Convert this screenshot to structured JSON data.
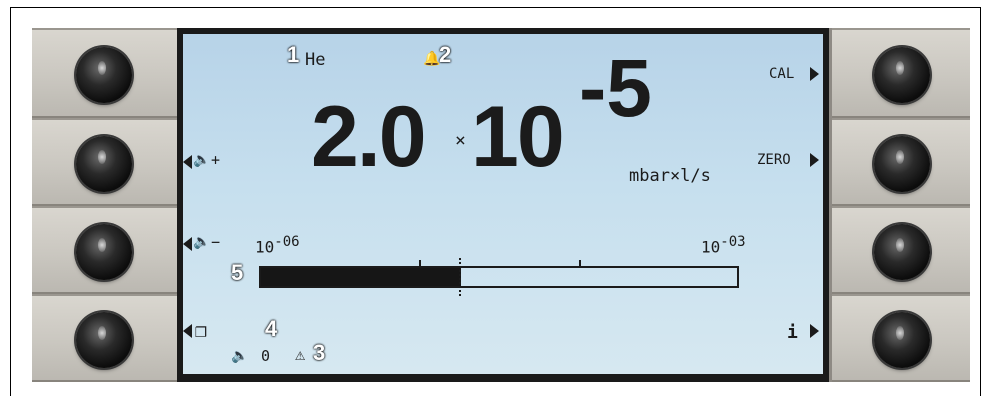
{
  "display": {
    "gas": "He",
    "mantissa": "2.0",
    "times_sign": "×",
    "base": "10",
    "exponent": "-5",
    "unit": "mbar×l/s",
    "bar_min_label": "10",
    "bar_min_exp": "-06",
    "bar_max_label": "10",
    "bar_max_exp": "-03",
    "bar_fill_fraction": 0.42,
    "volume_value": "0"
  },
  "softkeys": {
    "right_1": "CAL",
    "right_2": "ZERO",
    "right_4": "i",
    "left_2": "+",
    "left_3": "−"
  },
  "callouts": [
    "1",
    "2",
    "3",
    "4",
    "5"
  ],
  "colors": {
    "lcd_background": "#c6dfee",
    "lcd_text": "#1b1b1b",
    "panel": "#cac7c0",
    "knob": "#0d0d0d"
  }
}
